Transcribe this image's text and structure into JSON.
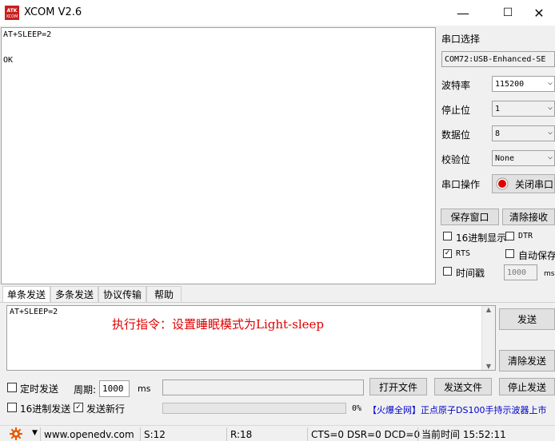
{
  "window": {
    "title": "XCOM V2.6",
    "logo_text": "ATK XCOM",
    "min_icon": "—",
    "max_icon": "☐",
    "close_icon": "✕"
  },
  "receive": {
    "lines": [
      "AT+SLEEP=2",
      "",
      "OK"
    ]
  },
  "panel": {
    "port_select_label": "串口选择",
    "port_value": "COM72:USB-Enhanced-SE",
    "baud_label": "波特率",
    "baud_value": "115200",
    "stop_label": "停止位",
    "stop_value": "1",
    "data_label": "数据位",
    "data_value": "8",
    "parity_label": "校验位",
    "parity_value": "None",
    "op_label": "串口操作",
    "close_port": "关闭串口",
    "save_window": "保存窗口",
    "clear_recv": "清除接收",
    "hex_display": "16进制显示",
    "dtr": "DTR",
    "rts": "RTS",
    "auto_save": "自动保存",
    "timestamp": "时间戳",
    "timestamp_value": "1000",
    "timestamp_unit": "ms"
  },
  "tabs": [
    "单条发送",
    "多条发送",
    "协议传输",
    "帮助"
  ],
  "send": {
    "text": "AT+SLEEP=2",
    "annotation": "执行指令：设置睡眠模式为Light-sleep",
    "send_btn": "发送",
    "clear_send_btn": "清除发送"
  },
  "bottom": {
    "timed_send": "定时发送",
    "period_label": "周期:",
    "period_value": "1000",
    "period_unit": "ms",
    "open_file": "打开文件",
    "send_file": "发送文件",
    "stop_send": "停止发送",
    "hex_send": "16进制发送",
    "send_newline": "发送新行",
    "progress_text": "0%",
    "progress": 0,
    "ad": "【火爆全网】正点原子DS100手持示波器上市"
  },
  "status": {
    "url": "www.openedv.com",
    "s": "S:12",
    "r": "R:18",
    "lines": "CTS=0 DSR=0 DCD=0",
    "time": "当前时间 15:52:11"
  },
  "colors": {
    "annotation": "#e00000",
    "ad": "#0000cc",
    "close_dot": "#e00000"
  },
  "icons": {
    "gear": "gear-icon",
    "dropdown": "chevron-down-icon"
  }
}
